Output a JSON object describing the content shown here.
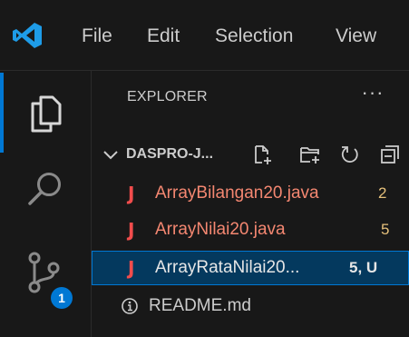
{
  "menu": {
    "file": "File",
    "edit": "Edit",
    "selection": "Selection",
    "view": "View"
  },
  "app_logo": "vscode-logo",
  "activity_bar": {
    "items": [
      {
        "icon": "files-icon",
        "active": true
      },
      {
        "icon": "search-icon",
        "active": false
      },
      {
        "icon": "source-control-icon",
        "active": false,
        "badge": "1"
      }
    ],
    "accent_color": "#0078d4"
  },
  "sidebar": {
    "title": "EXPLORER",
    "more_actions": "···",
    "folder": {
      "name": "DASPRO-J...",
      "expanded": true,
      "actions": [
        "new-file-icon",
        "new-folder-icon",
        "refresh-icon",
        "collapse-all-icon"
      ]
    },
    "files": [
      {
        "icon": "J",
        "name": "ArrayBilangan20.java",
        "status": "2",
        "selected": false
      },
      {
        "icon": "J",
        "name": "ArrayNilai20.java",
        "status": "5",
        "selected": false
      },
      {
        "icon": "J",
        "name": "ArrayRataNilai20...",
        "status": "5, U",
        "selected": true
      },
      {
        "icon": "info-icon",
        "name": "README.md",
        "status": "",
        "selected": false
      }
    ]
  },
  "colors": {
    "error_text": "#f48771",
    "warning_status": "#e5c07b",
    "java_icon": "#f14c4c",
    "selection_bg": "#04395e"
  }
}
